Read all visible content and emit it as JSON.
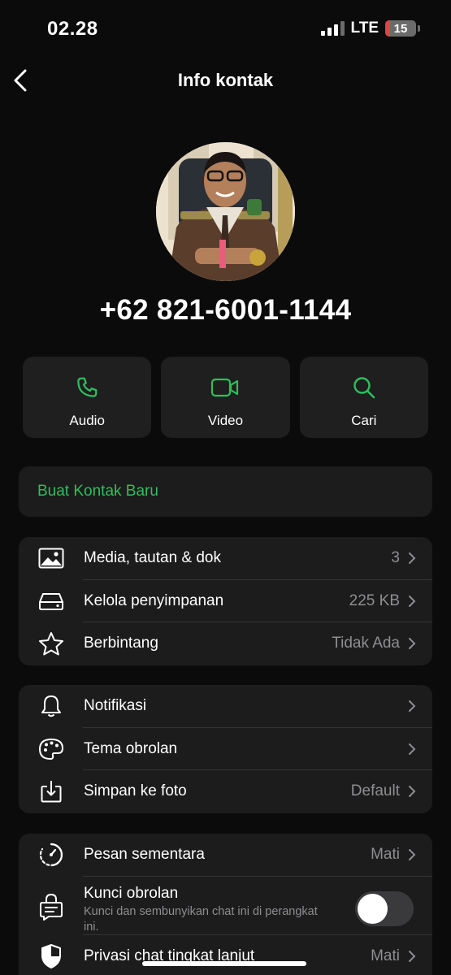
{
  "status_bar": {
    "time": "02.28",
    "network": "LTE",
    "battery": "15",
    "battery_level": 0.15
  },
  "nav": {
    "title": "Info kontak",
    "back_icon": "chevron-left-icon"
  },
  "profile": {
    "phone": "+62 821-6001-1144"
  },
  "actions": [
    {
      "label": "Audio",
      "icon": "phone-icon"
    },
    {
      "label": "Video",
      "icon": "video-camera-icon"
    },
    {
      "label": "Cari",
      "icon": "search-icon"
    }
  ],
  "new_contact": {
    "label": "Buat Kontak Baru"
  },
  "group1": [
    {
      "label": "Media, tautan & dok",
      "value": "3",
      "icon": "image-icon"
    },
    {
      "label": "Kelola penyimpanan",
      "value": "225 KB",
      "icon": "storage-icon"
    },
    {
      "label": "Berbintang",
      "value": "Tidak Ada",
      "icon": "star-icon"
    }
  ],
  "group2": [
    {
      "label": "Notifikasi",
      "value": "",
      "icon": "bell-icon"
    },
    {
      "label": "Tema obrolan",
      "value": "",
      "icon": "palette-icon"
    },
    {
      "label": "Simpan ke foto",
      "value": "Default",
      "icon": "download-icon"
    }
  ],
  "group3": {
    "disappearing": {
      "label": "Pesan sementara",
      "value": "Mati",
      "icon": "timer-icon"
    },
    "lock": {
      "label": "Kunci obrolan",
      "sub": "Kunci dan sembunyikan chat ini di perangkat ini.",
      "icon": "lock-chat-icon",
      "enabled": false
    },
    "privacy": {
      "label": "Privasi chat tingkat lanjut",
      "value": "Mati",
      "icon": "shield-icon"
    }
  },
  "colors": {
    "accent": "#2fbf5d",
    "card": "#1c1c1c",
    "background": "#0b0b0b",
    "battery_low": "#e0424a"
  }
}
